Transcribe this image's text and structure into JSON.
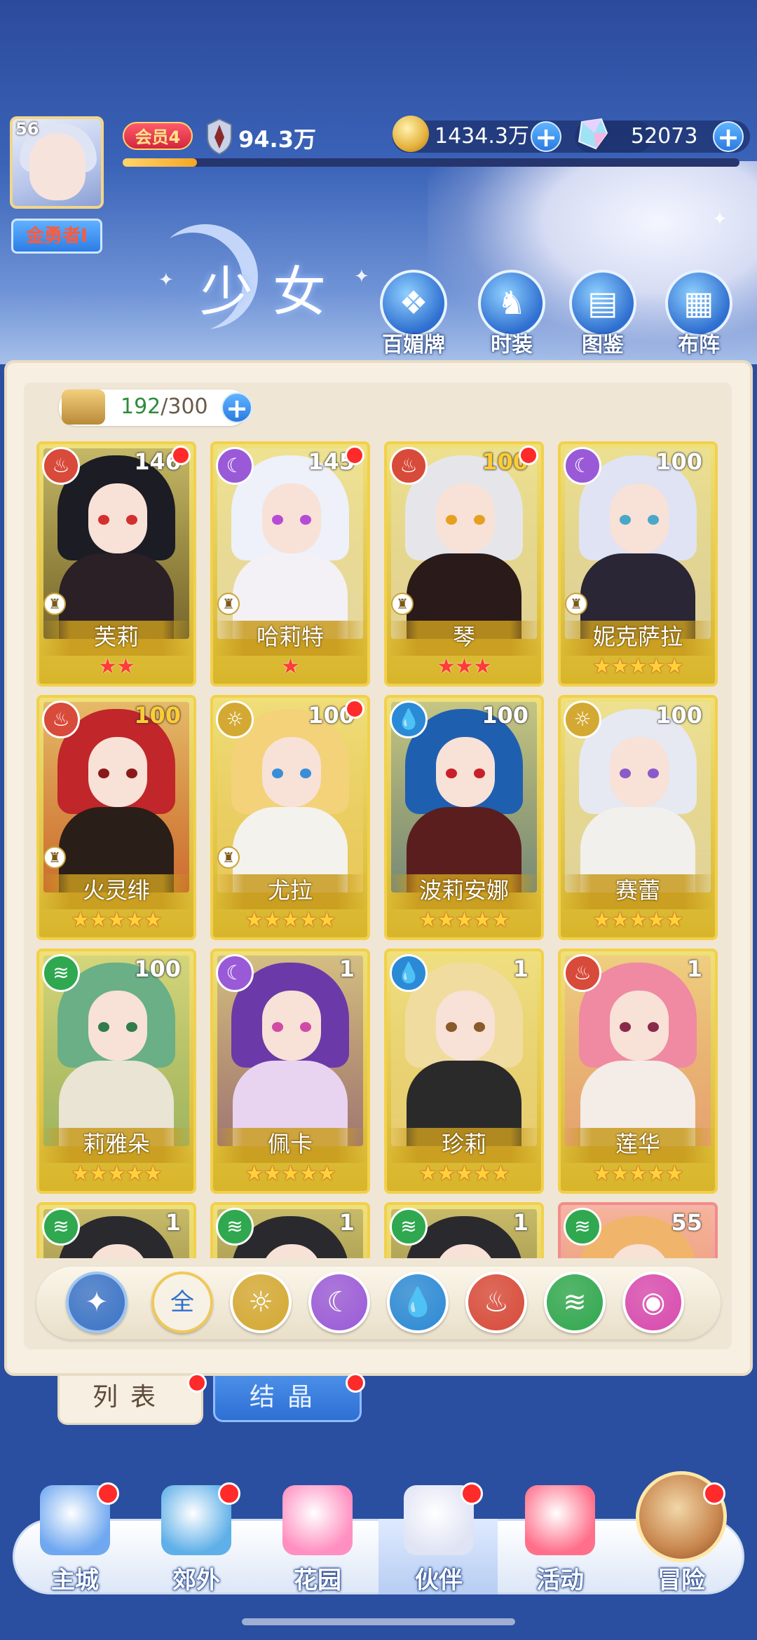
{
  "player": {
    "level": "56",
    "title": "金勇者I",
    "vip": "会员4",
    "power": "94.3万",
    "exp_progress": 0.12
  },
  "resources": {
    "gold": "1434.3万",
    "gems": "52073"
  },
  "banner": {
    "title": "少女"
  },
  "top_nav": [
    {
      "label": "百媚牌",
      "icon": "card-icon"
    },
    {
      "label": "时装",
      "icon": "outfit-icon"
    },
    {
      "label": "图鉴",
      "icon": "book-icon"
    },
    {
      "label": "布阵",
      "icon": "grid-icon"
    }
  ],
  "capacity": {
    "current": "192",
    "max": "300",
    "separator": "/"
  },
  "elements": {
    "fire": {
      "color": "#d84a3a",
      "glyph": "♨"
    },
    "moon": {
      "color": "#9a5ad8",
      "glyph": "☾"
    },
    "water": {
      "color": "#2b8ad6",
      "glyph": "💧"
    },
    "light": {
      "color": "#d4a933",
      "glyph": "☼"
    },
    "wind": {
      "color": "#2fa84f",
      "glyph": "≋"
    }
  },
  "companions": [
    {
      "name": "芙莉",
      "level": "146",
      "element": "fire",
      "stars": "★★",
      "star_color": "red",
      "pawn": true,
      "dot": true,
      "hair": "#1c1c24",
      "eye": "#d32f2f",
      "body": "#2a2026",
      "level_gold": false
    },
    {
      "name": "哈莉特",
      "level": "145",
      "element": "moon",
      "stars": "★",
      "star_color": "red",
      "pawn": true,
      "dot": true,
      "hair": "#eef0fa",
      "eye": "#b64bd6",
      "body": "#f3f1f6",
      "level_gold": false
    },
    {
      "name": "琴",
      "level": "100",
      "element": "fire",
      "stars": "★★★",
      "star_color": "red",
      "pawn": true,
      "dot": true,
      "hair": "#e6e6ea",
      "eye": "#e6a020",
      "body": "#2a1a1a",
      "level_gold": true
    },
    {
      "name": "妮克萨拉",
      "level": "100",
      "element": "moon",
      "stars": "★★★★★",
      "star_color": "gold",
      "pawn": true,
      "dot": false,
      "hair": "#dfe3f4",
      "eye": "#4aa7c9",
      "body": "#2a2636",
      "level_gold": false
    },
    {
      "name": "火灵绯",
      "level": "100",
      "element": "fire",
      "stars": "★★★★★",
      "star_color": "gold",
      "pawn": true,
      "dot": false,
      "hair": "#c0262a",
      "eye": "#8a1a1a",
      "body": "#2a1e18",
      "level_gold": true
    },
    {
      "name": "尤拉",
      "level": "100",
      "element": "light",
      "stars": "★★★★★",
      "star_color": "gold",
      "pawn": true,
      "dot": true,
      "hair": "#f3d27a",
      "eye": "#3a8ed8",
      "body": "#f4f2ec",
      "level_gold": false
    },
    {
      "name": "波莉安娜",
      "level": "100",
      "element": "water",
      "stars": "★★★★★",
      "star_color": "gold",
      "pawn": false,
      "dot": false,
      "hair": "#1f5fb0",
      "eye": "#c7202a",
      "body": "#5a1e1e",
      "level_gold": false
    },
    {
      "name": "赛蕾",
      "level": "100",
      "element": "light",
      "stars": "★★★★★",
      "star_color": "gold",
      "pawn": false,
      "dot": false,
      "hair": "#e6e8f2",
      "eye": "#8a5ac9",
      "body": "#f2f0ec",
      "level_gold": false
    },
    {
      "name": "莉雅朵",
      "level": "100",
      "element": "wind",
      "stars": "★★★★★",
      "star_color": "gold",
      "pawn": false,
      "dot": false,
      "hair": "#6aaf86",
      "eye": "#2e7d4a",
      "body": "#e9e4d4",
      "level_gold": false
    },
    {
      "name": "佩卡",
      "level": "1",
      "element": "moon",
      "stars": "★★★★★",
      "star_color": "gold",
      "pawn": false,
      "dot": false,
      "hair": "#6b3aa8",
      "eye": "#d04ba6",
      "body": "#e8d4f0",
      "level_gold": false
    },
    {
      "name": "珍莉",
      "level": "1",
      "element": "water",
      "stars": "★★★★★",
      "star_color": "gold",
      "pawn": false,
      "dot": false,
      "hair": "#f1dca0",
      "eye": "#8a5a2a",
      "body": "#2a2a2a",
      "level_gold": false
    },
    {
      "name": "莲华",
      "level": "1",
      "element": "fire",
      "stars": "★★★★★",
      "star_color": "gold",
      "pawn": false,
      "dot": false,
      "hair": "#ef8aa2",
      "eye": "#8a2a4a",
      "body": "#f4ece6",
      "level_gold": false
    },
    {
      "name": "",
      "level": "1",
      "element": "wind",
      "stars": "",
      "star_color": "gold",
      "pawn": false,
      "dot": false,
      "hair": "#2a2a2e",
      "eye": "#c7202a",
      "body": "#e2e2e2",
      "level_gold": false
    },
    {
      "name": "",
      "level": "1",
      "element": "wind",
      "stars": "",
      "star_color": "gold",
      "pawn": false,
      "dot": false,
      "hair": "#2a2a2e",
      "eye": "#c7202a",
      "body": "#e2e2e2",
      "level_gold": false
    },
    {
      "name": "",
      "level": "1",
      "element": "wind",
      "stars": "",
      "star_color": "gold",
      "pawn": false,
      "dot": false,
      "hair": "#2a2a2e",
      "eye": "#c7202a",
      "body": "#e2e2e2",
      "level_gold": false
    },
    {
      "name": "",
      "level": "55",
      "element": "wind",
      "stars": "",
      "star_color": "gold",
      "pawn": false,
      "dot": false,
      "hair": "#f0b56a",
      "eye": "#8a4a2a",
      "body": "#e2a08a",
      "level_gold": false,
      "red_frame": true
    }
  ],
  "filters": [
    {
      "name": "filter-rank-icon",
      "label": "✦",
      "color": "#3b74c8",
      "ring": "#9fc6f2"
    },
    {
      "name": "filter-all-button",
      "label": "全",
      "color": "#f7f2e6",
      "ring": "#f0c85a",
      "text_color": "#2f6fd0"
    },
    {
      "name": "filter-light-icon",
      "label": "☼",
      "color": "#d4a933",
      "ring": "#fff"
    },
    {
      "name": "filter-moon-icon",
      "label": "☾",
      "color": "#9a5ad8",
      "ring": "#fff"
    },
    {
      "name": "filter-water-icon",
      "label": "💧",
      "color": "#2b8ad6",
      "ring": "#fff"
    },
    {
      "name": "filter-fire-icon",
      "label": "♨",
      "color": "#d84a3a",
      "ring": "#fff"
    },
    {
      "name": "filter-wind-icon",
      "label": "≋",
      "color": "#2fa84f",
      "ring": "#fff"
    },
    {
      "name": "filter-special-icon",
      "label": "◉",
      "color": "#d84ab0",
      "ring": "#fff"
    }
  ],
  "tabs": {
    "list": "列表",
    "crystal": "结晶"
  },
  "bottom_nav": [
    {
      "label": "主城",
      "icon": "castle-icon",
      "color": "#6fa8f0",
      "dot": true
    },
    {
      "label": "郊外",
      "icon": "portal-icon",
      "color": "#5fb0e8",
      "dot": true
    },
    {
      "label": "花园",
      "icon": "heart-garden-icon",
      "color": "#ff8fc0",
      "dot": false
    },
    {
      "label": "伙伴",
      "icon": "companion-icon",
      "color": "#dfe3f4",
      "dot": true
    },
    {
      "label": "活动",
      "icon": "gift-icon",
      "color": "#ff6f8a",
      "dot": false
    },
    {
      "label": "冒险",
      "icon": "adventure-icon",
      "color": "#c9874f",
      "dot": true
    }
  ]
}
